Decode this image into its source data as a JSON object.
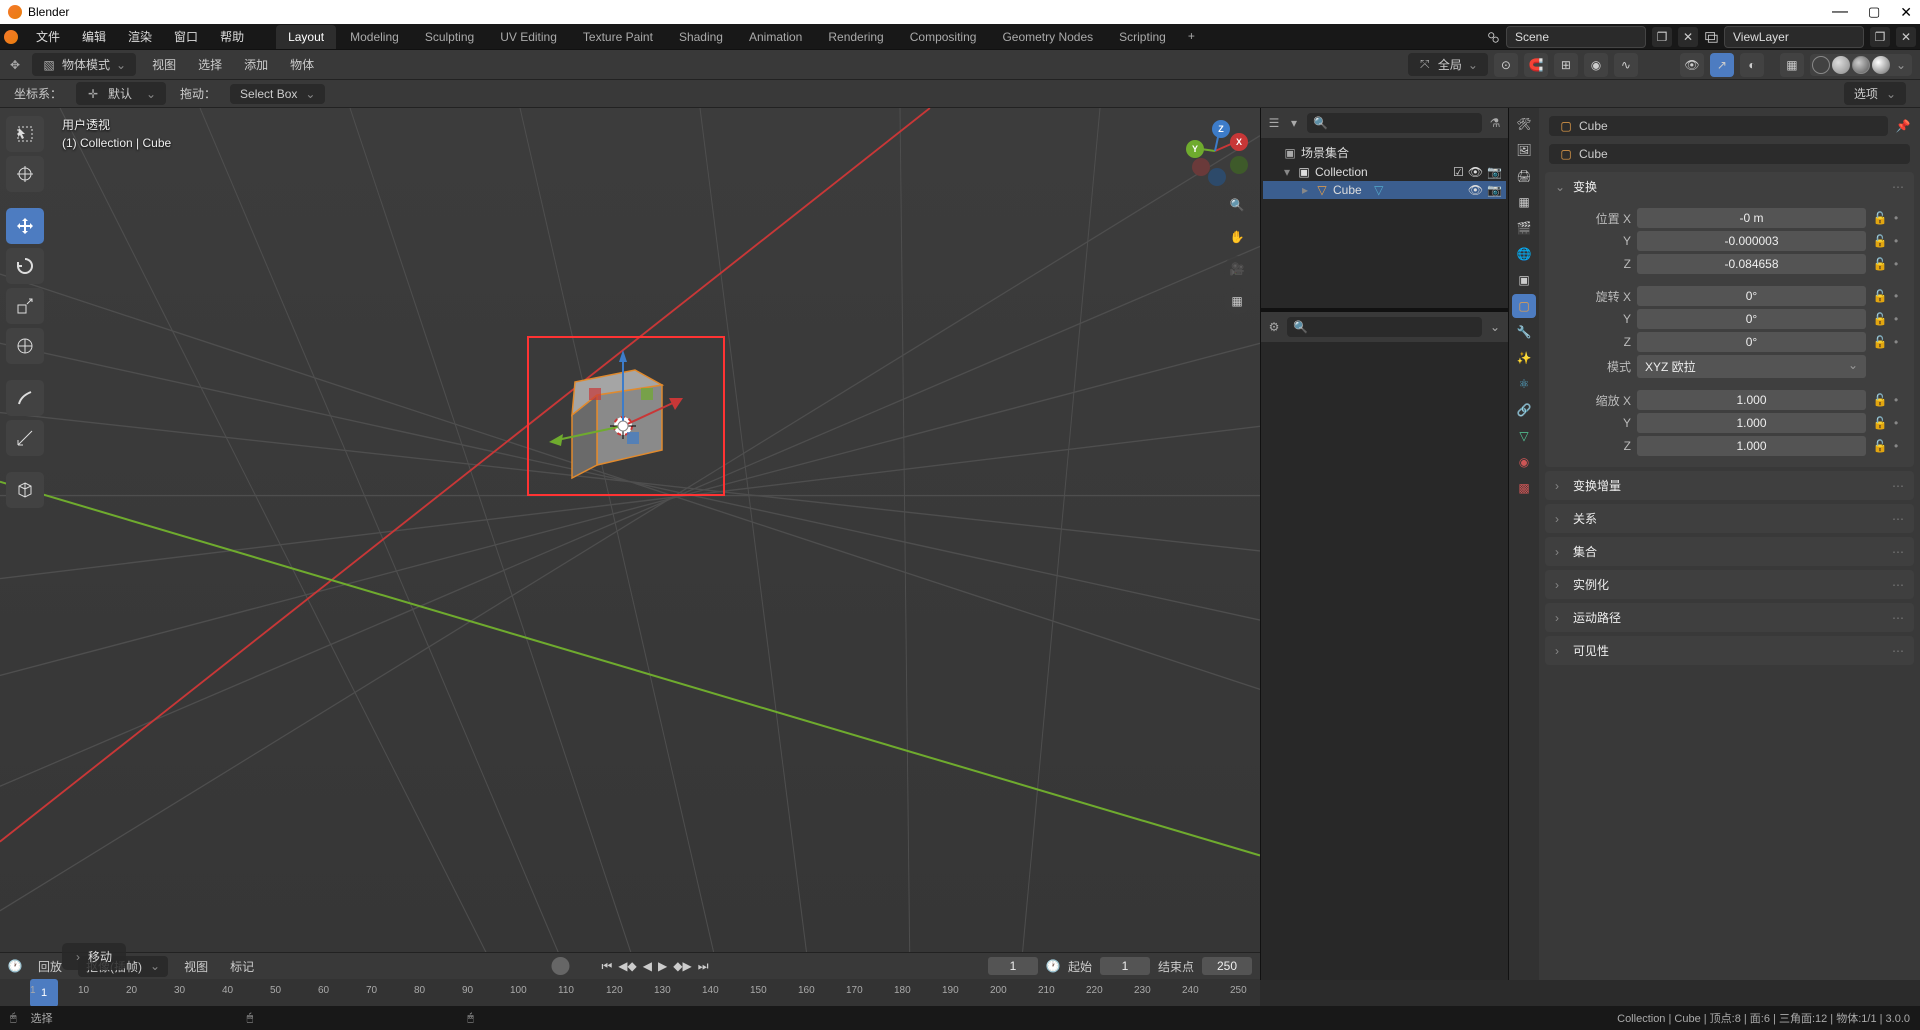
{
  "app": {
    "title": "Blender"
  },
  "menu": {
    "file": "文件",
    "edit": "编辑",
    "render": "渲染",
    "window": "窗口",
    "help": "帮助"
  },
  "workspaces": {
    "tabs": [
      "Layout",
      "Modeling",
      "Sculpting",
      "UV Editing",
      "Texture Paint",
      "Shading",
      "Animation",
      "Rendering",
      "Compositing",
      "Geometry Nodes",
      "Scripting"
    ],
    "active": 0
  },
  "topbar": {
    "scene": "Scene",
    "viewlayer": "ViewLayer"
  },
  "header2": {
    "mode": "物体模式",
    "view": "视图",
    "select": "选择",
    "add": "添加",
    "object": "物体",
    "pivot": "全局"
  },
  "header3": {
    "coord_label": "坐标系：",
    "coord_value": "默认",
    "drag_label": "拖动：",
    "drag_value": "Select Box",
    "options": "选项"
  },
  "viewport": {
    "persp": "用户透视",
    "breadcrumb": "(1) Collection | Cube",
    "move_label": "移动"
  },
  "outliner": {
    "root": "场景集合",
    "collection": "Collection",
    "object": "Cube"
  },
  "props": {
    "object_name": "Cube",
    "data_name": "Cube",
    "transform_title": "变换",
    "loc_label": "位置 X",
    "loc_x": "-0 m",
    "loc_y": "-0.000003",
    "loc_z": "-0.084658",
    "rot_label": "旋转 X",
    "rot_x": "0°",
    "rot_y": "0°",
    "rot_z": "0°",
    "rot_mode_label": "模式",
    "rot_mode": "XYZ 欧拉",
    "scale_label": "缩放 X",
    "scale_x": "1.000",
    "scale_y": "1.000",
    "scale_z": "1.000",
    "delta": "变换增量",
    "relations": "关系",
    "collection_sec": "集合",
    "instancing": "实例化",
    "motion": "运动路径",
    "visibility": "可见性"
  },
  "timeline": {
    "playback": "回放",
    "keying": "抠像(插帧)",
    "view": "视图",
    "marker": "标记",
    "current": "1",
    "start_label": "起始",
    "start": "1",
    "end_label": "结束点",
    "end": "250",
    "ticks": [
      "1",
      "10",
      "20",
      "30",
      "40",
      "50",
      "60",
      "70",
      "80",
      "90",
      "100",
      "110",
      "120",
      "130",
      "140",
      "150",
      "160",
      "170",
      "180",
      "190",
      "200",
      "210",
      "220",
      "230",
      "240",
      "250"
    ]
  },
  "status": {
    "select": "选择",
    "right": "Collection | Cube | 顶点:8 | 面:6 | 三角面:12 | 物体:1/1 | 3.0.0"
  }
}
